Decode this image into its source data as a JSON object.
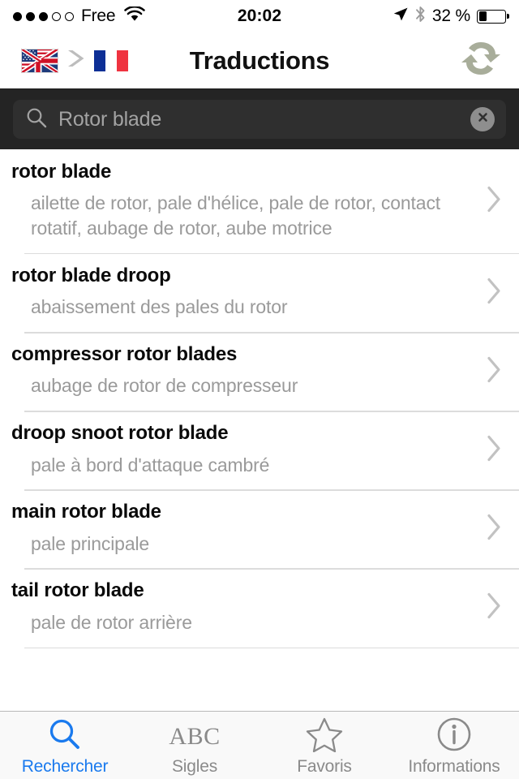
{
  "status_bar": {
    "signal_dots_filled": 3,
    "signal_dots_total": 5,
    "carrier": "Free",
    "wifi_icon": "wifi-icon",
    "time": "20:02",
    "location_icon": "location-arrow-icon",
    "bluetooth_icon": "bluetooth-icon",
    "battery_percent_label": "32 %",
    "battery_level": 32,
    "colors": {
      "text": "#000000",
      "bluetooth": "#9b9b9b"
    }
  },
  "nav_bar": {
    "source_flag_icon": "us-uk-flag-icon",
    "direction_icon": "chevron-right-icon",
    "target_flag_icon": "france-flag-icon",
    "title": "Traductions",
    "swap_icon": "swap-languages-icon",
    "colors": {
      "swap": "#a8ad9a",
      "arrow": "#bdbdbd",
      "border": "#1d1d1d"
    }
  },
  "search": {
    "icon": "search-icon",
    "value": "Rotor blade",
    "placeholder": "Rechercher",
    "clear_icon": "clear-circle-icon",
    "colors": {
      "bar_bg": "#242424",
      "field_bg": "#2f2f2f",
      "text": "#a3a3a3",
      "clear_bg": "#8e8e8e"
    }
  },
  "results": [
    {
      "term": "rotor blade",
      "translation": "ailette de rotor, pale d'hélice, pale de rotor, contact rotatif, aubage de rotor, aube motrice",
      "disclosure_icon": "chevron-right-icon"
    },
    {
      "term": "rotor blade droop",
      "translation": "abaissement des pales du rotor",
      "disclosure_icon": "chevron-right-icon"
    },
    {
      "term": "compressor rotor blades",
      "translation": "aubage de rotor de compresseur",
      "disclosure_icon": "chevron-right-icon"
    },
    {
      "term": "droop snoot rotor blade",
      "translation": "pale à bord d'attaque cambré",
      "disclosure_icon": "chevron-right-icon"
    },
    {
      "term": "main rotor blade",
      "translation": "pale principale",
      "disclosure_icon": "chevron-right-icon"
    },
    {
      "term": "tail rotor blade",
      "translation": "pale de rotor arrière",
      "disclosure_icon": "chevron-right-icon"
    }
  ],
  "tab_bar": {
    "active_index": 0,
    "active_color": "#1a7aee",
    "inactive_color": "#8a8a8a",
    "tabs": [
      {
        "label": "Rechercher",
        "icon": "search-icon"
      },
      {
        "label": "Sigles",
        "icon": "abc-icon",
        "glyph": "ABC"
      },
      {
        "label": "Favoris",
        "icon": "star-icon"
      },
      {
        "label": "Informations",
        "icon": "info-circle-icon"
      }
    ]
  }
}
